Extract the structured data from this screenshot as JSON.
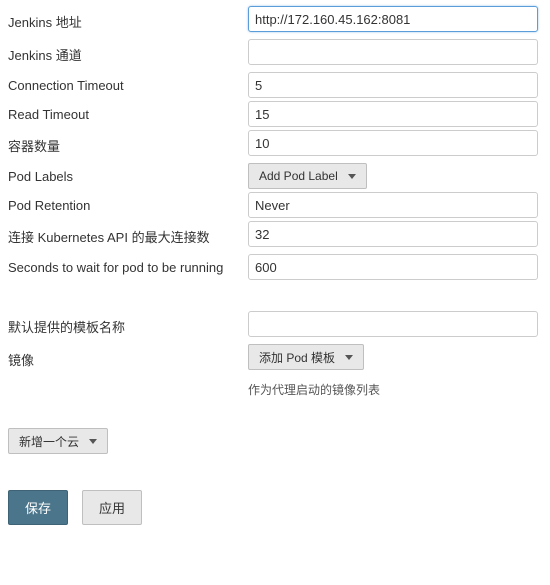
{
  "fields": {
    "jenkinsUrl": {
      "label": "Jenkins 地址",
      "value": "http://172.160.45.162:8081"
    },
    "jenkinsTunnel": {
      "label": "Jenkins 通道",
      "value": ""
    },
    "connTimeout": {
      "label": "Connection Timeout",
      "value": "5"
    },
    "readTimeout": {
      "label": "Read Timeout",
      "value": "15"
    },
    "containerCap": {
      "label": "容器数量",
      "value": "10"
    },
    "podLabels": {
      "label": "Pod Labels",
      "button": "Add Pod Label"
    },
    "podRetention": {
      "label": "Pod Retention",
      "value": "Never"
    },
    "maxConn": {
      "label": "连接 Kubernetes API 的最大连接数",
      "value": "32"
    },
    "waitPod": {
      "label": "Seconds to wait for pod to be running",
      "value": "600"
    },
    "defaultTemplate": {
      "label": "默认提供的模板名称",
      "value": ""
    },
    "images": {
      "label": "镜像",
      "button": "添加 Pod 模板",
      "help": "作为代理启动的镜像列表"
    }
  },
  "addCloud": "新增一个云",
  "save": "保存",
  "apply": "应用"
}
